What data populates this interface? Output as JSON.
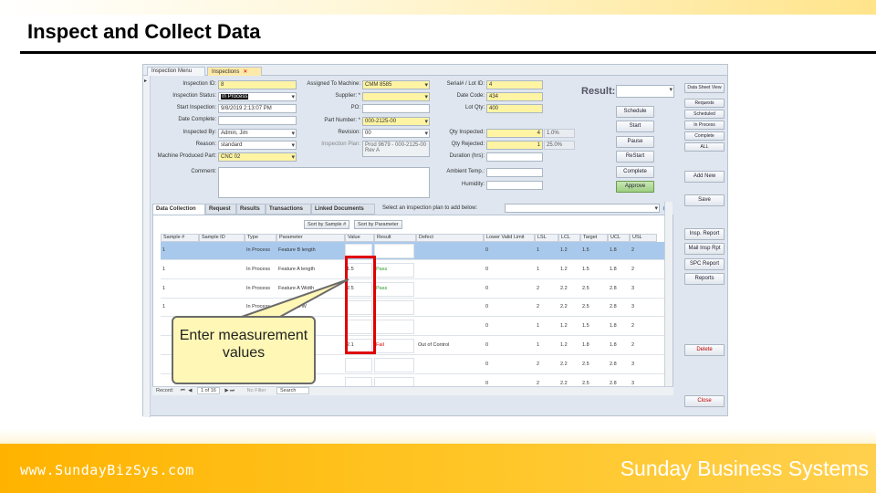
{
  "slide": {
    "title": "Inspect and Collect Data",
    "footer_url": "www.SundayBizSys.com",
    "footer_brand": "Sunday Business Systems",
    "callout": "Enter measurement values"
  },
  "app": {
    "tabs": [
      {
        "label": "Inspection Menu"
      },
      {
        "label": "Inspections",
        "close": "✕"
      }
    ],
    "form": {
      "inspection_id": {
        "label": "Inspection ID:",
        "value": "8"
      },
      "inspection_status": {
        "label": "Inspection Status:",
        "value": "In Process"
      },
      "start_inspection": {
        "label": "Start Inspection:",
        "value": "9/8/2019 2:13:07 PM"
      },
      "date_complete": {
        "label": "Date Complete:",
        "value": ""
      },
      "inspected_by": {
        "label": "Inspected By:",
        "value": "Admin, Jim"
      },
      "reason": {
        "label": "Reason:",
        "value": "standard"
      },
      "machine_produced_part": {
        "label": "Machine Produced Part:",
        "value": "CNC 02"
      },
      "comment": {
        "label": "Comment:",
        "value": ""
      },
      "assigned_to_machine": {
        "label": "Assigned To Machine:",
        "value": "CMM 8585"
      },
      "supplier": {
        "label": "Supplier: *",
        "value": ""
      },
      "po": {
        "label": "PO:",
        "value": ""
      },
      "part_number": {
        "label": "Part Number: *",
        "value": "000-2125-00"
      },
      "revision": {
        "label": "Revision:",
        "value": "00"
      },
      "inspection_plan": {
        "label": "Inspection Plan:",
        "value": "Prod 9679 - 000-2125-00 Rev A"
      },
      "serial_lot_id": {
        "label": "Serial# / Lot ID:",
        "value": "4"
      },
      "date_code": {
        "label": "Date Code:",
        "value": "434"
      },
      "lot_qty": {
        "label": "Lot Qty:",
        "value": "400"
      },
      "qty_inspected": {
        "label": "Qty Inspected:",
        "value": "4",
        "pct": "1.0%"
      },
      "qty_rejected": {
        "label": "Qty Rejected:",
        "value": "1",
        "pct": "25.0%"
      },
      "duration_hrs": {
        "label": "Duration (hrs):",
        "value": ""
      },
      "ambient_temp": {
        "label": "Ambient Temp.:",
        "value": ""
      },
      "humidity": {
        "label": "Humidity:",
        "value": ""
      },
      "result": {
        "label": "Result:",
        "value": ""
      }
    },
    "action_buttons": [
      "Schedule",
      "Start",
      "Pause",
      "ReStart",
      "Complete",
      "Approve"
    ],
    "side_buttons": {
      "data_sheet_view": "Data Sheet View",
      "filters": [
        "Requests",
        "Scheduled",
        "In Process",
        "Complete",
        "ALL"
      ],
      "add_new": "Add New",
      "save": "Save",
      "reports": [
        "Insp. Report",
        "Mail Insp Rpt",
        "SPC Report",
        "Reports"
      ],
      "delete": "Delete",
      "close": "Close"
    },
    "subtabs": [
      "Data Collection",
      "Request",
      "Results",
      "Transactions",
      "Linked Documents"
    ],
    "plan_select_label": "Select an inspection plan to add below:",
    "sort_buttons": [
      "Sort by Sample #",
      "Sort by Parameter"
    ],
    "grid": {
      "columns": [
        "Sample #",
        "Sample ID",
        "Type",
        "Parameter",
        "Value",
        "Result",
        "Defect",
        "Lower Valid Limit",
        "LSL",
        "LCL",
        "Target",
        "UCL",
        "USL"
      ],
      "rows": [
        {
          "sample": "1",
          "sample_id": "",
          "type": "In Process",
          "parameter": "Feature B length",
          "value": "",
          "result": "",
          "defect": "",
          "lvl": "0",
          "lsl": "1",
          "lcl": "1.2",
          "target": "1.5",
          "ucl": "1.8",
          "usl": "2"
        },
        {
          "sample": "1",
          "sample_id": "",
          "type": "In Process",
          "parameter": "Feature A length",
          "value": "1.5",
          "result": "Pass",
          "defect": "",
          "lvl": "0",
          "lsl": "1",
          "lcl": "1.2",
          "target": "1.5",
          "ucl": "1.8",
          "usl": "2"
        },
        {
          "sample": "1",
          "sample_id": "",
          "type": "In Process",
          "parameter": "Feature A Width",
          "value": "2.5",
          "result": "Pass",
          "defect": "",
          "lvl": "0",
          "lsl": "2",
          "lcl": "2.2",
          "target": "2.5",
          "ucl": "2.8",
          "usl": "3"
        },
        {
          "sample": "1",
          "sample_id": "",
          "type": "In Process",
          "parameter": "Feature B W",
          "value": "",
          "result": "",
          "defect": "",
          "lvl": "0",
          "lsl": "2",
          "lcl": "2.2",
          "target": "2.5",
          "ucl": "2.8",
          "usl": "3"
        },
        {
          "sample": "",
          "sample_id": "",
          "type": "",
          "parameter": "gth",
          "value": "",
          "result": "",
          "defect": "",
          "lvl": "0",
          "lsl": "1",
          "lcl": "1.2",
          "target": "1.5",
          "ucl": "1.8",
          "usl": "2"
        },
        {
          "sample": "",
          "sample_id": "",
          "type": "",
          "parameter": "gth",
          "value": "2.1",
          "result": "Fail",
          "defect": "Out of Control",
          "lvl": "0",
          "lsl": "1",
          "lcl": "1.2",
          "target": "1.8",
          "ucl": "1.8",
          "usl": "2"
        },
        {
          "sample": "",
          "sample_id": "",
          "type": "",
          "parameter": "dth",
          "value": "",
          "result": "",
          "defect": "",
          "lvl": "0",
          "lsl": "2",
          "lcl": "2.2",
          "target": "2.5",
          "ucl": "2.8",
          "usl": "3"
        },
        {
          "sample": "",
          "sample_id": "",
          "type": "",
          "parameter": "dth",
          "value": "",
          "result": "",
          "defect": "",
          "lvl": "0",
          "lsl": "2",
          "lcl": "2.2",
          "target": "2.5",
          "ucl": "2.8",
          "usl": "3"
        }
      ]
    },
    "status_bar": {
      "record_label": "Record:",
      "record_pos": "1 of 16",
      "no_filter": "No Filter",
      "search": "Search"
    }
  }
}
